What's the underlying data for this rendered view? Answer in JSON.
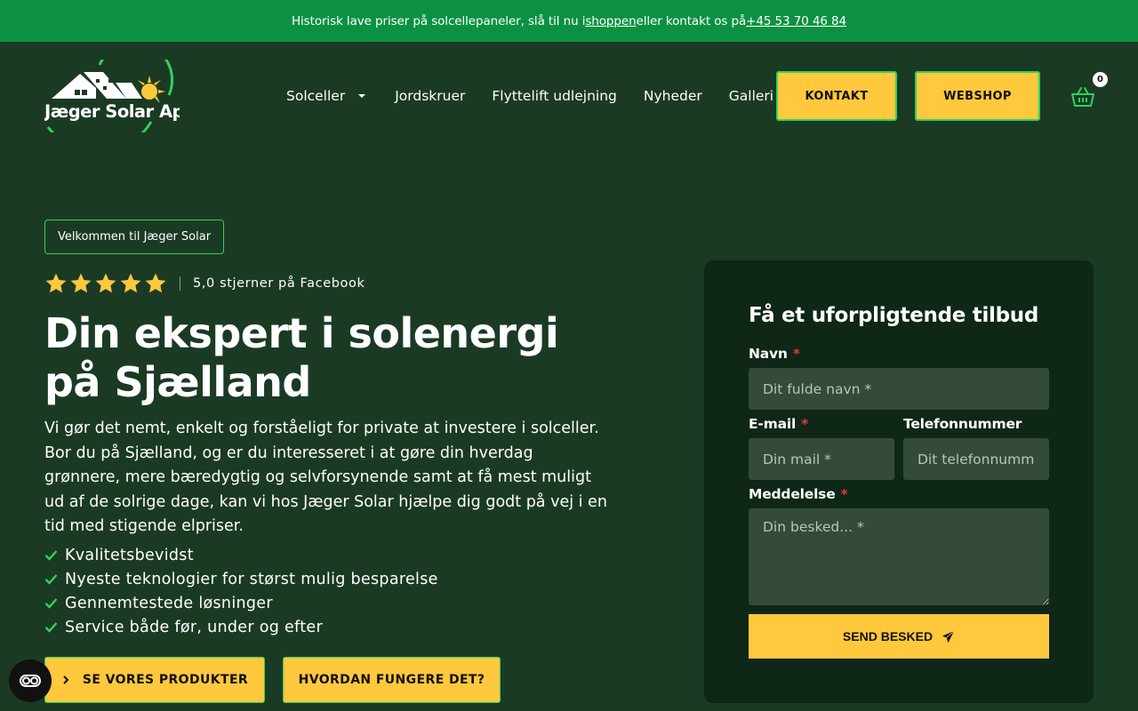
{
  "topbar": {
    "text_before": "Historisk lave priser på solcellepaneler, slå til nu i ",
    "shop_link": "shoppen",
    "text_middle": " eller kontakt os på ",
    "phone_link": "+45 53 70 46 84"
  },
  "logo": {
    "text": "Jæger Solar ApS"
  },
  "nav": {
    "items": [
      "Solceller",
      "Jordskruer",
      "Flyttelift udlejning",
      "Nyheder",
      "Galleri"
    ],
    "kontakt": "KONTAKT",
    "webshop": "WEBSHOP",
    "cart_count": "0"
  },
  "hero": {
    "badge": "Velkommen til Jæger Solar",
    "star_count": 5,
    "rating_text": "5,0 stjerner på Facebook",
    "title": "Din ekspert i solenergi på Sjælland",
    "description": "Vi gør det nemt, enkelt og forståeligt for private at investere i solceller. Bor du på Sjælland, og er du interesseret i at gøre din hverdag grønnere, mere bæredygtig og selvforsynende samt at få mest muligt ud af de solrige dage, kan vi hos Jæger Solar hjælpe dig godt på vej i en tid med stigende elpriser.",
    "checklist": [
      "Kvalitetsbevidst",
      "Nyeste teknologier for størst mulig besparelse",
      "Gennemtestede løsninger",
      "Service både før, under og efter"
    ],
    "cta_products": "SE VORES PRODUKTER",
    "cta_how": "HVORDAN FUNGERE DET?"
  },
  "form": {
    "title": "Få et uforpligtende tilbud",
    "name_label": "Navn",
    "name_placeholder": "Dit fulde navn *",
    "email_label": "E-mail",
    "email_placeholder": "Din mail *",
    "phone_label": "Telefonnummer",
    "phone_placeholder": "Dit telefonnummer",
    "message_label": "Meddelelse",
    "message_placeholder": "Din besked... *",
    "required_mark": "*",
    "submit": "SEND BESKED"
  },
  "colors": {
    "topbar": "#0c9142",
    "background": "#1b3a24",
    "card": "#0e2716",
    "accent_yellow": "#ffc83d",
    "accent_green": "#2fd25d"
  }
}
